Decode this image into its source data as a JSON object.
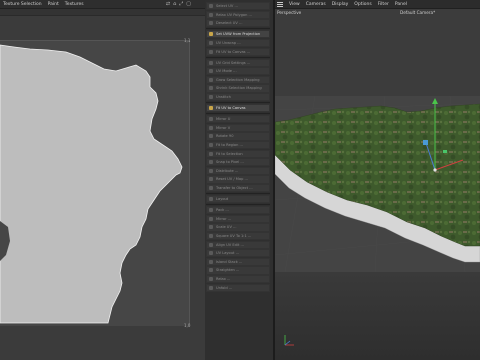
{
  "uv_editor": {
    "menu": [
      "Texture Selection",
      "Paint",
      "Textures"
    ],
    "toolbar_icons": [
      "link-icon",
      "home-icon",
      "expand-icon",
      "view-icon"
    ],
    "corner_top": "1,1",
    "corner_bottom": "1,0"
  },
  "commands": [
    {
      "label": "Select UV ...",
      "hl": false
    },
    {
      "label": "Relax UV Polygon ...",
      "hl": false
    },
    {
      "label": "Deselect UV ...",
      "hl": false
    },
    {
      "label": "Set UVW from Projection",
      "hl": true
    },
    {
      "label": "UV Unwrap ...",
      "hl": false
    },
    {
      "label": "Fit UV to Canvas ...",
      "hl": false
    },
    {
      "label": "UV Grid Settings ...",
      "hl": false
    },
    {
      "label": "UV Mode ...",
      "hl": false
    },
    {
      "label": "Grow Selection Mapping",
      "hl": false
    },
    {
      "label": "Shrink Selection Mapping",
      "hl": false
    },
    {
      "label": "Unstitch",
      "hl": false
    },
    {
      "label": "Fit UV to Canvas",
      "hl": true
    },
    {
      "label": "Mirror U",
      "hl": false
    },
    {
      "label": "Mirror V",
      "hl": false
    },
    {
      "label": "Rotate 90",
      "hl": false
    },
    {
      "label": "Fit to Region ...",
      "hl": false
    },
    {
      "label": "Fit to Selection",
      "hl": false
    },
    {
      "label": "Snap to Pixel ...",
      "hl": false
    },
    {
      "label": "Distribute ...",
      "hl": false
    },
    {
      "label": "Reset UV / Map ...",
      "hl": false
    },
    {
      "label": "Transfer to Object ...",
      "hl": false
    },
    {
      "label": "Layout",
      "hl": false
    },
    {
      "label": "Pack ...",
      "hl": false
    },
    {
      "label": "Mirror ...",
      "hl": false
    },
    {
      "label": "Scale UV ...",
      "hl": false
    },
    {
      "label": "Square UV To 1:1 ...",
      "hl": false
    },
    {
      "label": "Align UV Edit ...",
      "hl": false
    },
    {
      "label": "UV Layout ...",
      "hl": false
    },
    {
      "label": "Island Stack ...",
      "hl": false
    },
    {
      "label": "Straighten ...",
      "hl": false
    },
    {
      "label": "Relax ...",
      "hl": false
    },
    {
      "label": "Unfold ...",
      "hl": false
    }
  ],
  "viewport": {
    "menu": [
      "View",
      "Cameras",
      "Display",
      "Options",
      "Filter",
      "Panel"
    ],
    "projection": "Perspective",
    "camera": "Default Camera"
  },
  "colors": {
    "uv_shape": "#bdbdbd",
    "highlight_icon": "#c9a64a",
    "terrain_green": "#3e5a2c",
    "axis_green": "#4ac44a",
    "axis_blue": "#4a7bd6",
    "axis_red": "#d04040"
  }
}
